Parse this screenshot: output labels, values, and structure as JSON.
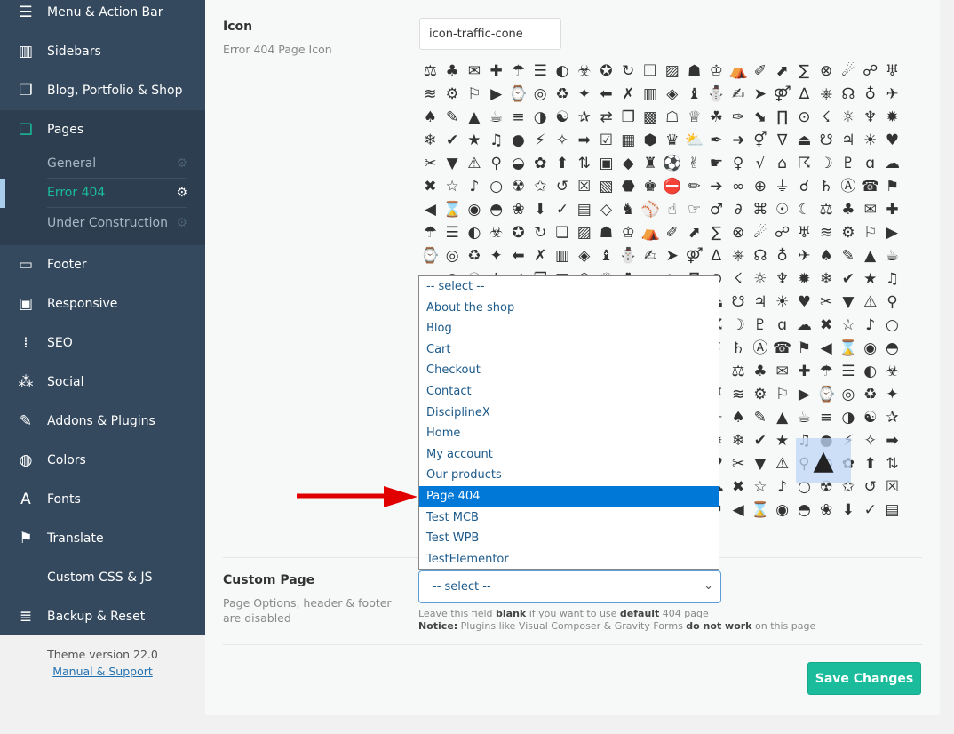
{
  "sidebar": {
    "items": [
      {
        "label": "Menu & Action Bar",
        "icon": "menu-icon",
        "glyph": "☰"
      },
      {
        "label": "Sidebars",
        "icon": "sidebar-icon",
        "glyph": "▥"
      },
      {
        "label": "Blog, Portfolio & Shop",
        "icon": "blog-icon",
        "glyph": "❐"
      },
      {
        "label": "Pages",
        "icon": "pages-icon",
        "glyph": "❏"
      },
      {
        "label": "Footer",
        "icon": "footer-icon",
        "glyph": "▭"
      },
      {
        "label": "Responsive",
        "icon": "responsive-icon",
        "glyph": "▣"
      },
      {
        "label": "SEO",
        "icon": "seo-icon",
        "glyph": "⁞"
      },
      {
        "label": "Social",
        "icon": "social-icon",
        "glyph": "⁂"
      },
      {
        "label": "Addons & Plugins",
        "icon": "plug-icon",
        "glyph": "✎"
      },
      {
        "label": "Colors",
        "icon": "paint-bucket-icon",
        "glyph": "◍"
      },
      {
        "label": "Fonts",
        "icon": "font-icon",
        "glyph": "A"
      },
      {
        "label": "Translate",
        "icon": "flag-icon",
        "glyph": "⚑"
      },
      {
        "label": "Custom CSS & JS",
        "icon": "code-icon",
        "glyph": "</>"
      },
      {
        "label": "Backup & Reset",
        "icon": "database-icon",
        "glyph": "≣"
      }
    ],
    "subitems": [
      {
        "label": "General"
      },
      {
        "label": "Error 404",
        "active": true
      },
      {
        "label": "Under Construction"
      }
    ],
    "theme_version": "Theme version 22.0",
    "manual_link": "Manual & Support"
  },
  "icon_field": {
    "label": "Icon",
    "description": "Error 404 Page Icon",
    "value": "icon-traffic-cone",
    "selected_icon": "traffic-cone-icon"
  },
  "custom_page": {
    "label": "Custom Page",
    "description": "Page Options, header & footer are disabled",
    "value": "-- select --",
    "options": [
      "-- select --",
      "About the shop",
      "Blog",
      "Cart",
      "Checkout",
      "Contact",
      "DisciplineX",
      "Home",
      "My account",
      "Our products",
      "Page 404",
      "Test MCB",
      "Test WPB",
      "TestElementor"
    ],
    "highlighted": "Page 404",
    "help1": [
      "Leave this field ",
      "blank",
      " if you want to use ",
      "default",
      " 404 page"
    ],
    "help2": [
      "Notice:",
      " Plugins like Visual Composer & Gravity Forms ",
      "do not work",
      " on this page"
    ]
  },
  "save_label": "Save Changes",
  "colors": {
    "sidebar": "#34495e",
    "accent": "#1abc9c",
    "highlight": "#0078d7",
    "arrow": "#e00000"
  }
}
